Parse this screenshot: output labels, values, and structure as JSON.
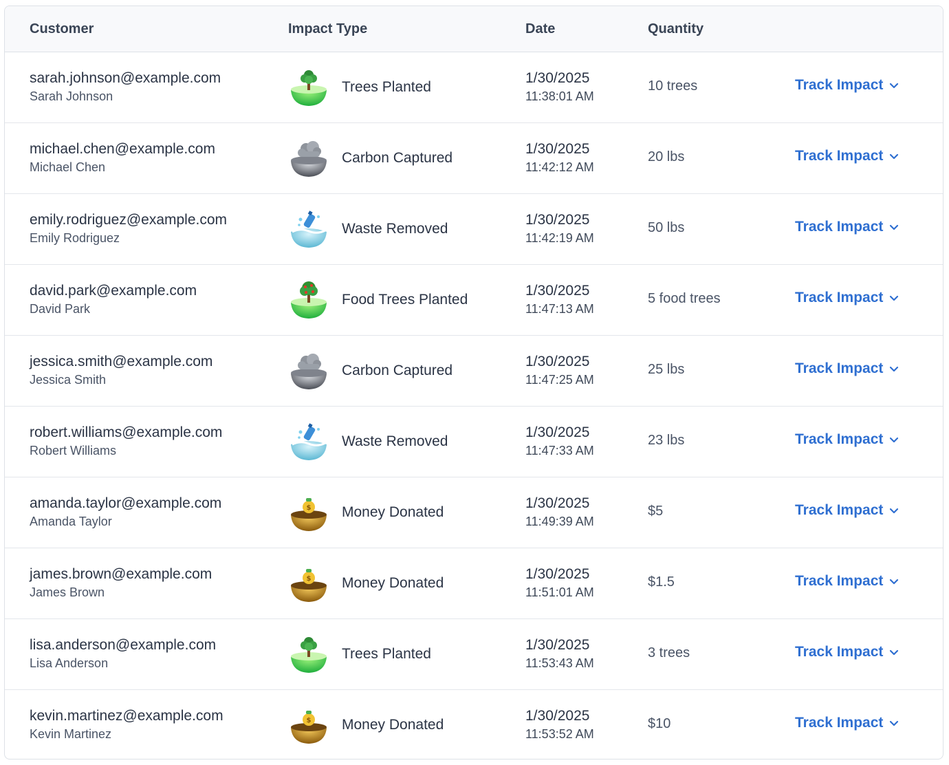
{
  "headers": {
    "customer": "Customer",
    "impact_type": "Impact Type",
    "date": "Date",
    "quantity": "Quantity"
  },
  "colors": {
    "accent": "#2f6fd1",
    "header_bg": "#f8f9fb",
    "border": "#dde1e7"
  },
  "rows": [
    {
      "email": "sarah.johnson@example.com",
      "name": "Sarah Johnson",
      "impact": "Trees Planted",
      "icon": "tree-icon",
      "date": "1/30/2025",
      "time": "11:38:01 AM",
      "quantity": "10 trees",
      "action": "Track Impact"
    },
    {
      "email": "michael.chen@example.com",
      "name": "Michael Chen",
      "impact": "Carbon Captured",
      "icon": "cloud-icon",
      "date": "1/30/2025",
      "time": "11:42:12 AM",
      "quantity": "20 lbs",
      "action": "Track Impact"
    },
    {
      "email": "emily.rodriguez@example.com",
      "name": "Emily Rodriguez",
      "impact": "Waste Removed",
      "icon": "water-bottle-icon",
      "date": "1/30/2025",
      "time": "11:42:19 AM",
      "quantity": "50 lbs",
      "action": "Track Impact"
    },
    {
      "email": "david.park@example.com",
      "name": "David Park",
      "impact": "Food Trees Planted",
      "icon": "fruit-tree-icon",
      "date": "1/30/2025",
      "time": "11:47:13 AM",
      "quantity": "5 food trees",
      "action": "Track Impact"
    },
    {
      "email": "jessica.smith@example.com",
      "name": "Jessica Smith",
      "impact": "Carbon Captured",
      "icon": "cloud-icon",
      "date": "1/30/2025",
      "time": "11:47:25 AM",
      "quantity": "25 lbs",
      "action": "Track Impact"
    },
    {
      "email": "robert.williams@example.com",
      "name": "Robert Williams",
      "impact": "Waste Removed",
      "icon": "water-bottle-icon",
      "date": "1/30/2025",
      "time": "11:47:33 AM",
      "quantity": "23 lbs",
      "action": "Track Impact"
    },
    {
      "email": "amanda.taylor@example.com",
      "name": "Amanda Taylor",
      "impact": "Money Donated",
      "icon": "money-bag-icon",
      "date": "1/30/2025",
      "time": "11:49:39 AM",
      "quantity": "$5",
      "action": "Track Impact"
    },
    {
      "email": "james.brown@example.com",
      "name": "James Brown",
      "impact": "Money Donated",
      "icon": "money-bag-icon",
      "date": "1/30/2025",
      "time": "11:51:01 AM",
      "quantity": "$1.5",
      "action": "Track Impact"
    },
    {
      "email": "lisa.anderson@example.com",
      "name": "Lisa Anderson",
      "impact": "Trees Planted",
      "icon": "tree-icon",
      "date": "1/30/2025",
      "time": "11:53:43 AM",
      "quantity": "3 trees",
      "action": "Track Impact"
    },
    {
      "email": "kevin.martinez@example.com",
      "name": "Kevin Martinez",
      "impact": "Money Donated",
      "icon": "money-bag-icon",
      "date": "1/30/2025",
      "time": "11:53:52 AM",
      "quantity": "$10",
      "action": "Track Impact"
    }
  ]
}
